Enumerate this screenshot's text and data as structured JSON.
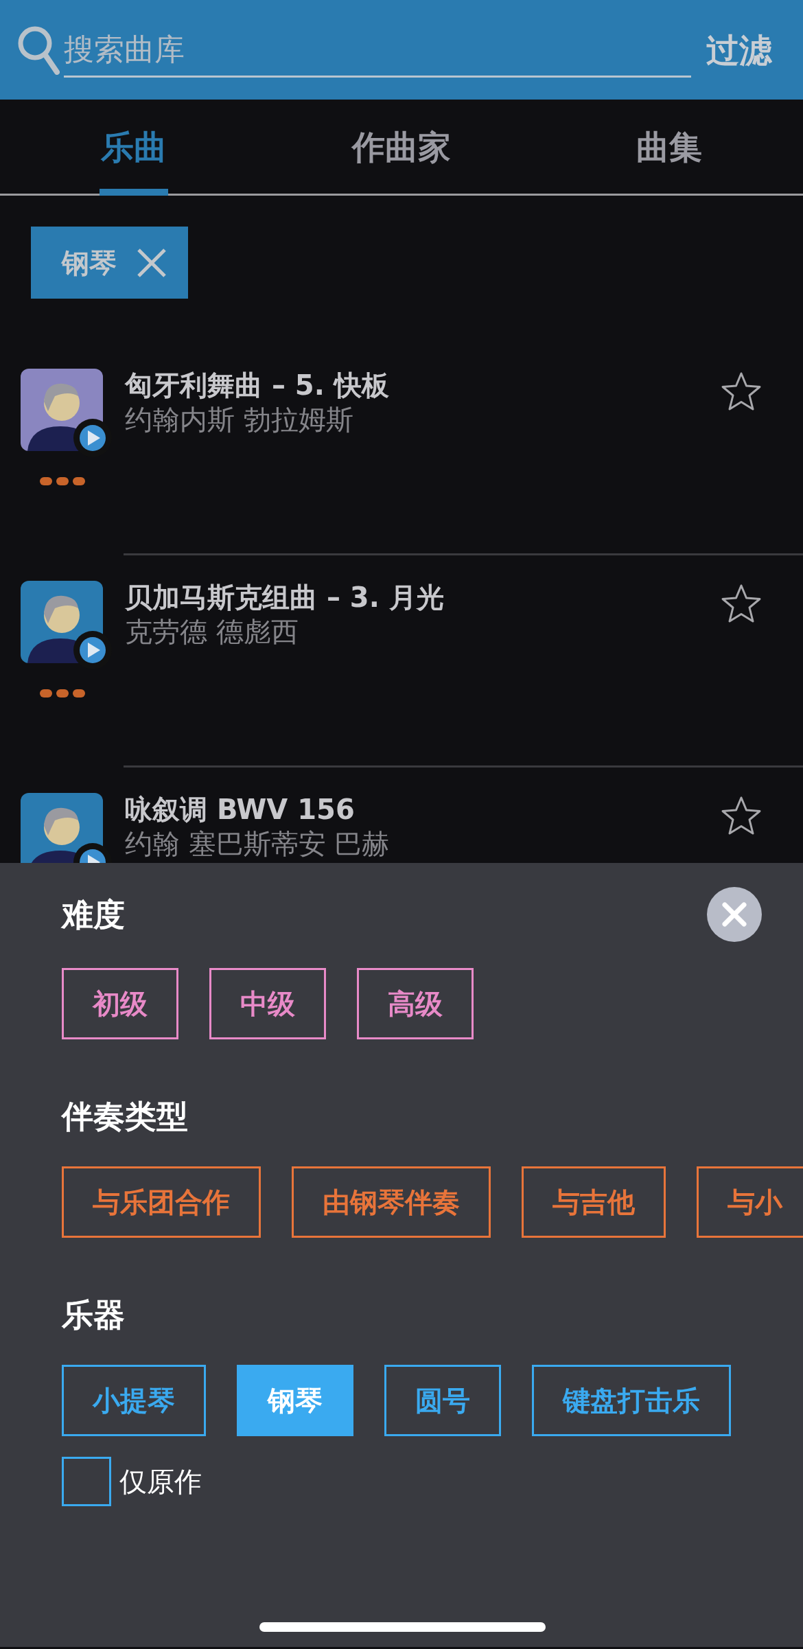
{
  "search": {
    "placeholder": "搜索曲库",
    "filter_label": "过滤"
  },
  "tabs": [
    {
      "label": "乐曲",
      "selected": true
    },
    {
      "label": "作曲家",
      "selected": false
    },
    {
      "label": "曲集",
      "selected": false
    }
  ],
  "active_filters": [
    {
      "label": "钢琴"
    }
  ],
  "pieces": [
    {
      "title": "匈牙利舞曲 – 5. 快板",
      "composer": "约翰内斯 勃拉姆斯",
      "color": "#8a86c0",
      "favorite": false,
      "rating_dots": true
    },
    {
      "title": "贝加马斯克组曲 – 3. 月光",
      "composer": "克劳德 德彪西",
      "color": "#2a7bb0",
      "favorite": false,
      "rating_dots": true
    },
    {
      "title": "咏叙调 BWV 156",
      "composer": "约翰 塞巴斯蒂安 巴赫",
      "color": "#2a7bb0",
      "favorite": false
    }
  ],
  "filter_sheet": {
    "sections": [
      {
        "heading": "难度",
        "color": "#e88ac8",
        "options": [
          {
            "label": "初级",
            "selected": false
          },
          {
            "label": "中级",
            "selected": false
          },
          {
            "label": "高级",
            "selected": false
          }
        ]
      },
      {
        "heading": "伴奏类型",
        "color": "#e8743a",
        "options": [
          {
            "label": "与乐团合作",
            "selected": false
          },
          {
            "label": "由钢琴伴奏",
            "selected": false
          },
          {
            "label": "与吉他",
            "selected": false
          },
          {
            "label": "与小",
            "selected": false
          }
        ]
      },
      {
        "heading": "乐器",
        "color": "#3aaaf0",
        "options": [
          {
            "label": "小提琴",
            "selected": false
          },
          {
            "label": "钢琴",
            "selected": true
          },
          {
            "label": "圆号",
            "selected": false
          },
          {
            "label": "键盘打击乐",
            "selected": false
          }
        ]
      }
    ],
    "original_only": {
      "label": "仅原作",
      "checked": false
    }
  }
}
